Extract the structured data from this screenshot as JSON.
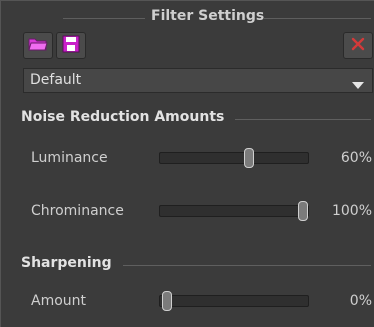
{
  "panel": {
    "title": "Filter Settings"
  },
  "toolbar": {
    "open_icon": "folder-open-icon",
    "save_icon": "save-floppy-icon",
    "close_icon": "close-x-icon"
  },
  "preset": {
    "value": "Default"
  },
  "sections": {
    "noise": {
      "title": "Noise Reduction Amounts"
    },
    "sharpening": {
      "title": "Sharpening"
    }
  },
  "controls": {
    "luminance": {
      "label": "Luminance",
      "value_text": "60%",
      "value": 0.6
    },
    "chrominance": {
      "label": "Chrominance",
      "value_text": "100%",
      "value": 1.0
    },
    "amount": {
      "label": "Amount",
      "value_text": "0%",
      "value": 0.0
    }
  },
  "colors": {
    "folder": "#d83bd8",
    "save": "#c91ec9",
    "close_x": "#d23a3a"
  }
}
